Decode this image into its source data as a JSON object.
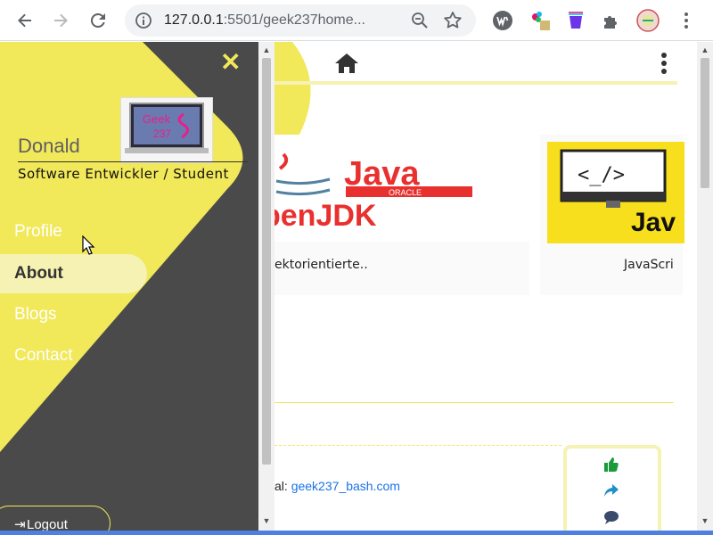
{
  "browser": {
    "url_host": "127.0.0.1",
    "url_rest": ":5501/geek237home...",
    "icons": [
      "back-icon",
      "forward-icon",
      "reload-icon",
      "info-icon",
      "zoom-icon",
      "star-icon",
      "wappalyzer-icon",
      "color-extension-icon",
      "paint-bucket-icon",
      "puzzle-icon",
      "profile-icon",
      "menu-dots-icon"
    ]
  },
  "sidebar": {
    "close_label": "✕",
    "user_name": "Donald",
    "user_title": "Software Entwickler / Student",
    "nav": [
      {
        "label": "Profile",
        "active": false
      },
      {
        "label": "About",
        "active": true
      },
      {
        "label": "Blogs",
        "active": false
      },
      {
        "label": "Contact",
        "active": false
      }
    ],
    "logout_label": "Logout"
  },
  "avatar": {
    "line1": "Geek",
    "line2": "237"
  },
  "main": {
    "cards": [
      {
        "logo_java": "Java",
        "logo_oracle": "ORACLE",
        "logo_jdk": "penJDK",
        "caption": "ektorientierte.."
      },
      {
        "logo_code": "<_/>",
        "logo_text": "Jav",
        "caption": "JavaScri"
      }
    ],
    "mail_prefix": "al: ",
    "mail_link": "geek237_bash.com"
  },
  "colors": {
    "accent_yellow": "#f1e85a",
    "sidebar_dark": "#4a4a4a",
    "active_pill": "#f6f2b3",
    "link_blue": "#1a73e8"
  }
}
